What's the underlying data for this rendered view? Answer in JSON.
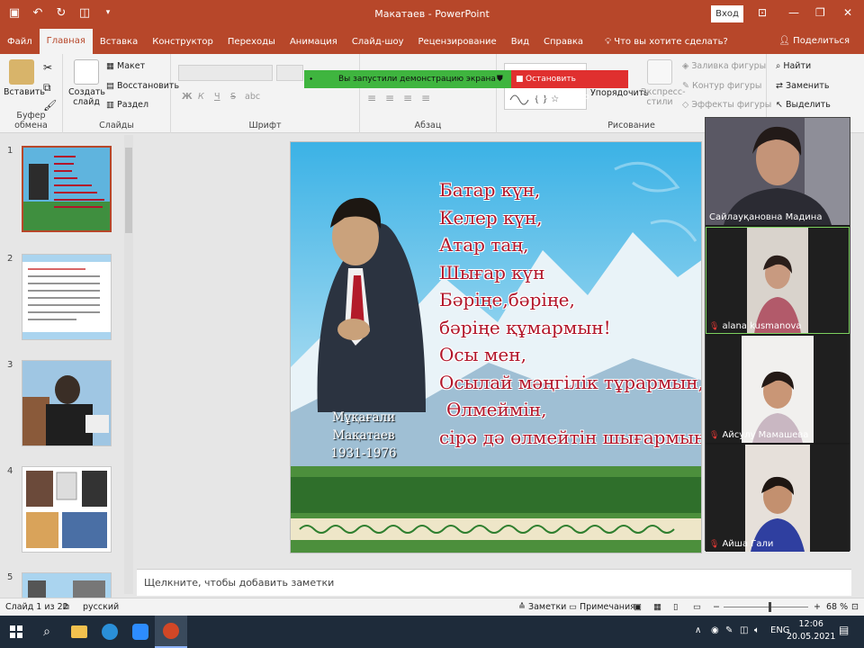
{
  "window": {
    "title": "Макатаев - PowerPoint",
    "sign_in": "Вход"
  },
  "tabs": [
    "Файл",
    "Главная",
    "Вставка",
    "Конструктор",
    "Переходы",
    "Анимация",
    "Слайд-шоу",
    "Рецензирование",
    "Вид",
    "Справка"
  ],
  "tell_me": "Что вы хотите сделать?",
  "share": "Поделиться",
  "ribbon": {
    "paste": "Вставить",
    "clipboard_group": "Буфер обмена",
    "new_slide": "Создать слайд",
    "layout": "Макет",
    "reset": "Восстановить",
    "section": "Раздел",
    "slides_group": "Слайды",
    "font_group": "Шрифт",
    "paragraph_group": "Абзац",
    "arrange": "Упорядочить",
    "quick_styles": "Экспресс-стили",
    "shape_fill": "Заливка фигуры",
    "shape_outline": "Контур фигуры",
    "shape_effects": "Эффекты фигуры",
    "drawing_group": "Рисование",
    "find": "Найти",
    "replace": "Заменить",
    "select": "Выделить",
    "bold": "Ж",
    "italic": "К",
    "underline": "Ч",
    "strike": "S",
    "shadow": "abc"
  },
  "share_banner": {
    "message": "Вы запустили демонстрацию экрана",
    "stop": "Остановить демонстрацию"
  },
  "thumbnails": [
    "1",
    "2",
    "3",
    "4",
    "5"
  ],
  "slide": {
    "poem": [
      "Батар күн,",
      "Келер күн,",
      "Атар таң,",
      "Шығар күн",
      "Бәріңе,бәріңе,",
      "бәріңе құмармын!",
      "Осы мен,",
      "Осылай мәңгілік тұрармын,",
      "Өлмеймін,",
      "сірә дә өлмейтін шығармын!"
    ],
    "caption_name": "Мұқағали Мақатаев",
    "caption_years": "1931-1976"
  },
  "participants": [
    "Сайлауқановна Мадина",
    "alana kusmanova",
    "Айсулу Мамашева",
    "Айша Гали"
  ],
  "notes_placeholder": "Щелкните, чтобы добавить заметки",
  "status": {
    "slide_count": "Слайд 1 из 22",
    "language": "русский",
    "notes": "Заметки",
    "comments": "Примечания",
    "zoom": "68 %"
  },
  "taskbar": {
    "lang": "ENG",
    "time": "12:06",
    "date": "20.05.2021"
  },
  "colors": {
    "accent": "#b7472a",
    "banner_green": "#3fb53f",
    "banner_red": "#e0302f",
    "poem_text": "#b2162a",
    "taskbar": "#1e2b3a"
  }
}
